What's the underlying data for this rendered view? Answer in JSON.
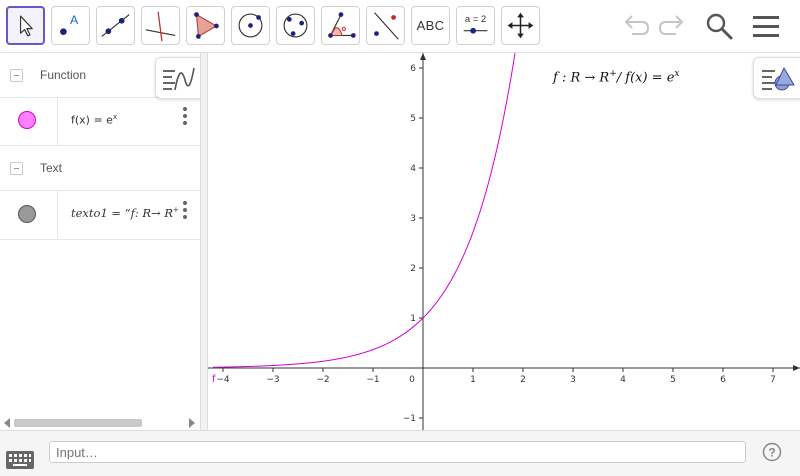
{
  "toolbar": {
    "tools": [
      {
        "name": "move-tool",
        "icon": "arrow-pointer-icon"
      },
      {
        "name": "point-tool",
        "icon": "point-A-icon"
      },
      {
        "name": "line-tool",
        "icon": "line-through-two-points-icon"
      },
      {
        "name": "perpendicular-line-tool",
        "icon": "perpendicular-line-icon"
      },
      {
        "name": "polygon-tool",
        "icon": "polygon-icon"
      },
      {
        "name": "circle-center-point-tool",
        "icon": "circle-center-icon"
      },
      {
        "name": "circle-three-points-tool",
        "icon": "circle-three-points-icon"
      },
      {
        "name": "angle-tool",
        "icon": "angle-icon"
      },
      {
        "name": "reflect-tool",
        "icon": "reflect-about-line-icon"
      },
      {
        "name": "text-tool",
        "label": "ABC"
      },
      {
        "name": "slider-tool",
        "label": "a = 2"
      },
      {
        "name": "move-graphics-view-tool",
        "icon": "move-arrows-icon"
      }
    ],
    "right": [
      "undo-icon",
      "redo-icon",
      "search-icon",
      "menu-icon"
    ]
  },
  "algebra": {
    "groups": [
      {
        "label": "Function",
        "items": [
          {
            "definition": "f(x) = e",
            "exponent": "x",
            "color": "#ff80ff"
          }
        ]
      },
      {
        "label": "Text",
        "items": [
          {
            "definition": "texto1 = “f:  R→ R",
            "exponent": "+",
            "color": "#999999"
          }
        ]
      }
    ]
  },
  "graphics": {
    "formula": {
      "text": "f :  R → R",
      "sup1": "+",
      "mid": "/  f(x) = e",
      "sup2": "x"
    },
    "function_label": "f",
    "function_color": "#d400d4",
    "x_ticks": [
      "−4",
      "−3",
      "−2",
      "−1",
      "0",
      "1",
      "2",
      "3",
      "4",
      "5",
      "6",
      "7"
    ],
    "y_ticks": [
      "6",
      "5",
      "4",
      "3",
      "2",
      "1",
      "−1"
    ]
  },
  "input": {
    "placeholder": "Input…"
  }
}
